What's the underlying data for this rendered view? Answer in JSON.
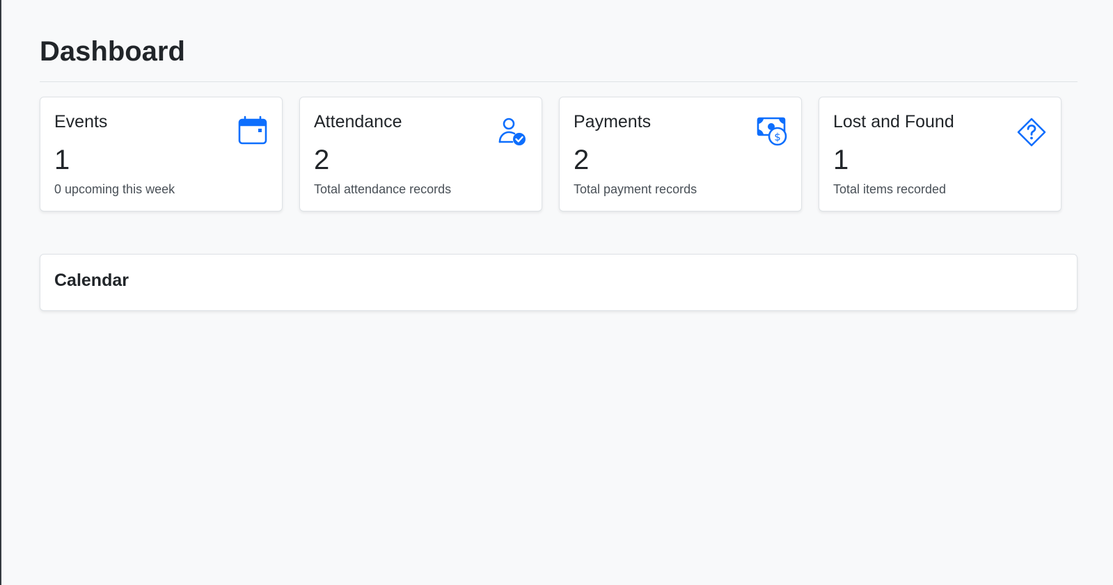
{
  "page": {
    "title": "Dashboard"
  },
  "colors": {
    "accent": "#0d6efd",
    "background": "#f8f9fa",
    "card": "#ffffff",
    "muted_text": "#495057"
  },
  "stats": [
    {
      "title": "Events",
      "value": "1",
      "subtitle": "0 upcoming this week",
      "icon": "calendar-icon"
    },
    {
      "title": "Attendance",
      "value": "2",
      "subtitle": "Total attendance records",
      "icon": "person-check-icon"
    },
    {
      "title": "Payments",
      "value": "2",
      "subtitle": "Total payment records",
      "icon": "cash-coin-icon"
    },
    {
      "title": "Lost and Found",
      "value": "1",
      "subtitle": "Total items recorded",
      "icon": "question-diamond-icon"
    }
  ],
  "calendar": {
    "title": "Calendar"
  }
}
